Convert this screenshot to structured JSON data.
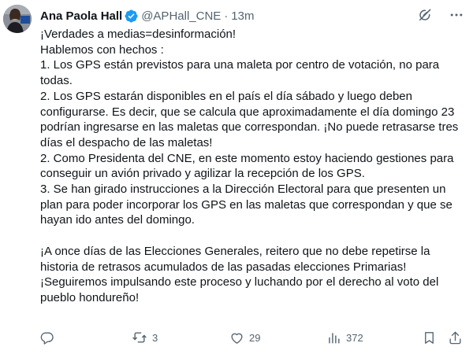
{
  "author": {
    "display_name": "Ana Paola Hall",
    "handle": "@APHall_CNE",
    "separator": "·",
    "time": "13m",
    "verified": true
  },
  "tweet": {
    "lines": [
      "¡Verdades a medias=desinformación!",
      "Hablemos con hechos :",
      "1. Los GPS están previstos para una maleta por centro de votación, no para todas.",
      "2. Los GPS estarán disponibles en el país  el día sábado y luego deben configurarse. Es decir, que se calcula que aproximadamente el día domingo 23 podrían ingresarse en las maletas que correspondan. ¡No puede retrasarse tres días el despacho de las maletas!",
      "2. Como Presidenta del CNE, en este momento estoy haciendo gestiones para conseguir un avión privado y agilizar la recepción de los GPS.",
      "3. Se han girado instrucciones a la Dirección Electoral para que presenten un plan para poder incorporar los GPS en las maletas que correspondan y que se hayan ido antes del domingo.",
      "",
      "¡A once días de las Elecciones Generales, reitero que no debe repetirse la historia de retrasos acumulados de las pasadas elecciones Primarias! ¡Seguiremos impulsando este proceso y luchando por el derecho al voto del pueblo hondureño!"
    ]
  },
  "stats": {
    "reposts": "3",
    "likes": "29",
    "views": "372"
  },
  "icons": {
    "top": [
      "grok-icon",
      "more-icon"
    ],
    "actions": [
      "reply-icon",
      "repost-icon",
      "like-icon",
      "views-icon",
      "bookmark-icon",
      "share-icon"
    ]
  },
  "colors": {
    "text": "#0f1419",
    "secondary": "#536471",
    "verified": "#1d9bf0",
    "background": "#ffffff"
  }
}
